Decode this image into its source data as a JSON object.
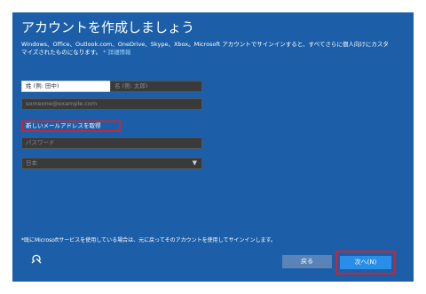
{
  "title": "アカウントを作成しましょう",
  "description": "Windows、Office、Outlook.com、OneDrive、Skype、Xbox。Microsoft アカウントでサインインすると、すべてさらに個人向けにカスタマイズされたものになります。",
  "details_link": "* 詳細情報",
  "fields": {
    "last_name_placeholder": "姓 (例: 田中)",
    "first_name_placeholder": "名 (例: 太郎)",
    "email_placeholder": "someone@example.com",
    "password_placeholder": "パスワード",
    "country_value": "日本"
  },
  "new_email_link": "新しいメールアドレスを取得",
  "note": "*既にMicrosoftサービスを使用している場合は、元に戻ってそのアカウントを使用してサインインします。",
  "buttons": {
    "back": "戻る",
    "next": "次へ(N)"
  },
  "colors": {
    "background": "#1c5fa8",
    "highlight": "#d0222f",
    "next_button": "#2a8ee8"
  },
  "icons": {
    "accessibility": "ease-of-access-icon",
    "dropdown": "chevron-down-icon"
  }
}
